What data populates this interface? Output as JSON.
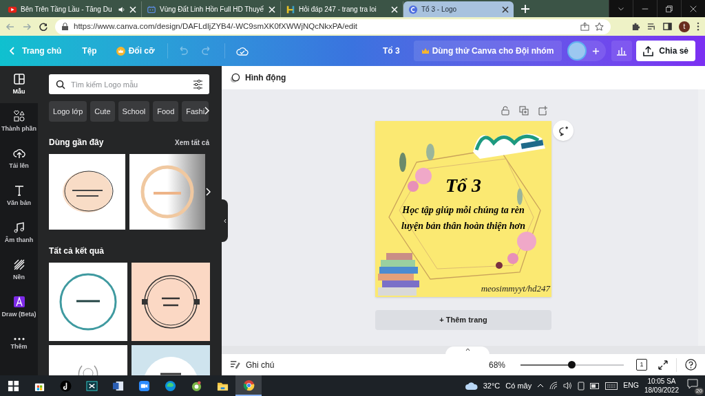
{
  "browser": {
    "tabs": [
      {
        "title": "Bên Trên Tầng Lầu - Tăng Du",
        "audio": true,
        "selected": false
      },
      {
        "title": "Vùng Đất Linh Hồn Full HD Thuyế",
        "audio": false,
        "selected": false
      },
      {
        "title": "Hỏi đáp 247 - trang tra loi",
        "audio": false,
        "selected": false
      },
      {
        "title": "Tổ 3 - Logo",
        "audio": false,
        "selected": true
      }
    ],
    "url": "https://www.canva.com/design/DAFLdIjZYB4/-WC9smXK0fXWWjNQcNkxPA/edit",
    "profile": "t"
  },
  "top_bar": {
    "home": "Trang chủ",
    "file": "Tệp",
    "resize": "Đổi cỡ",
    "design_title": "Tổ 3",
    "trial": "Dùng thử Canva cho Đội nhóm",
    "share": "Chia sẻ"
  },
  "rail": [
    {
      "label": "Mẫu",
      "kind": "templates",
      "selected": true
    },
    {
      "label": "Thành phần",
      "kind": "elements",
      "selected": false
    },
    {
      "label": "Tải lên",
      "kind": "uploads",
      "selected": false
    },
    {
      "label": "Văn bản",
      "kind": "text",
      "selected": false
    },
    {
      "label": "Âm thanh",
      "kind": "audio",
      "selected": false
    },
    {
      "label": "Nền",
      "kind": "background",
      "selected": false
    },
    {
      "label": "Draw (Beta)",
      "kind": "draw",
      "selected": false
    },
    {
      "label": "Thêm",
      "kind": "more",
      "selected": false
    }
  ],
  "panel": {
    "search": {
      "placeholder": "Tìm kiếm Logo mẫu"
    },
    "chips": [
      "Logo lớp",
      "Cute",
      "School",
      "Food",
      "Fashi"
    ],
    "recent": {
      "heading": "Dùng gần đây",
      "see_all": "Xem tất cả"
    },
    "results": {
      "heading": "Tất cả kết quả"
    }
  },
  "editor": {
    "animate": "Hình động",
    "design": {
      "title": "Tổ 3",
      "lines": [
        "Học tập giúp mỗi chúng ta rèn",
        "luyện bản thân hoàn thiện hơn"
      ],
      "signature": "meosimmyyt/hd247"
    },
    "add_page": "+ Thêm trang"
  },
  "footer": {
    "notes": "Ghi chú",
    "zoom": "68%",
    "zoom_slider": {
      "level": 0.49
    },
    "page_count": "1"
  },
  "taskbar": {
    "weather": "32°C",
    "condition": "Có mây",
    "language": "ENG",
    "time": "10:05 SA",
    "date": "18/09/2022",
    "notifications": "20"
  }
}
